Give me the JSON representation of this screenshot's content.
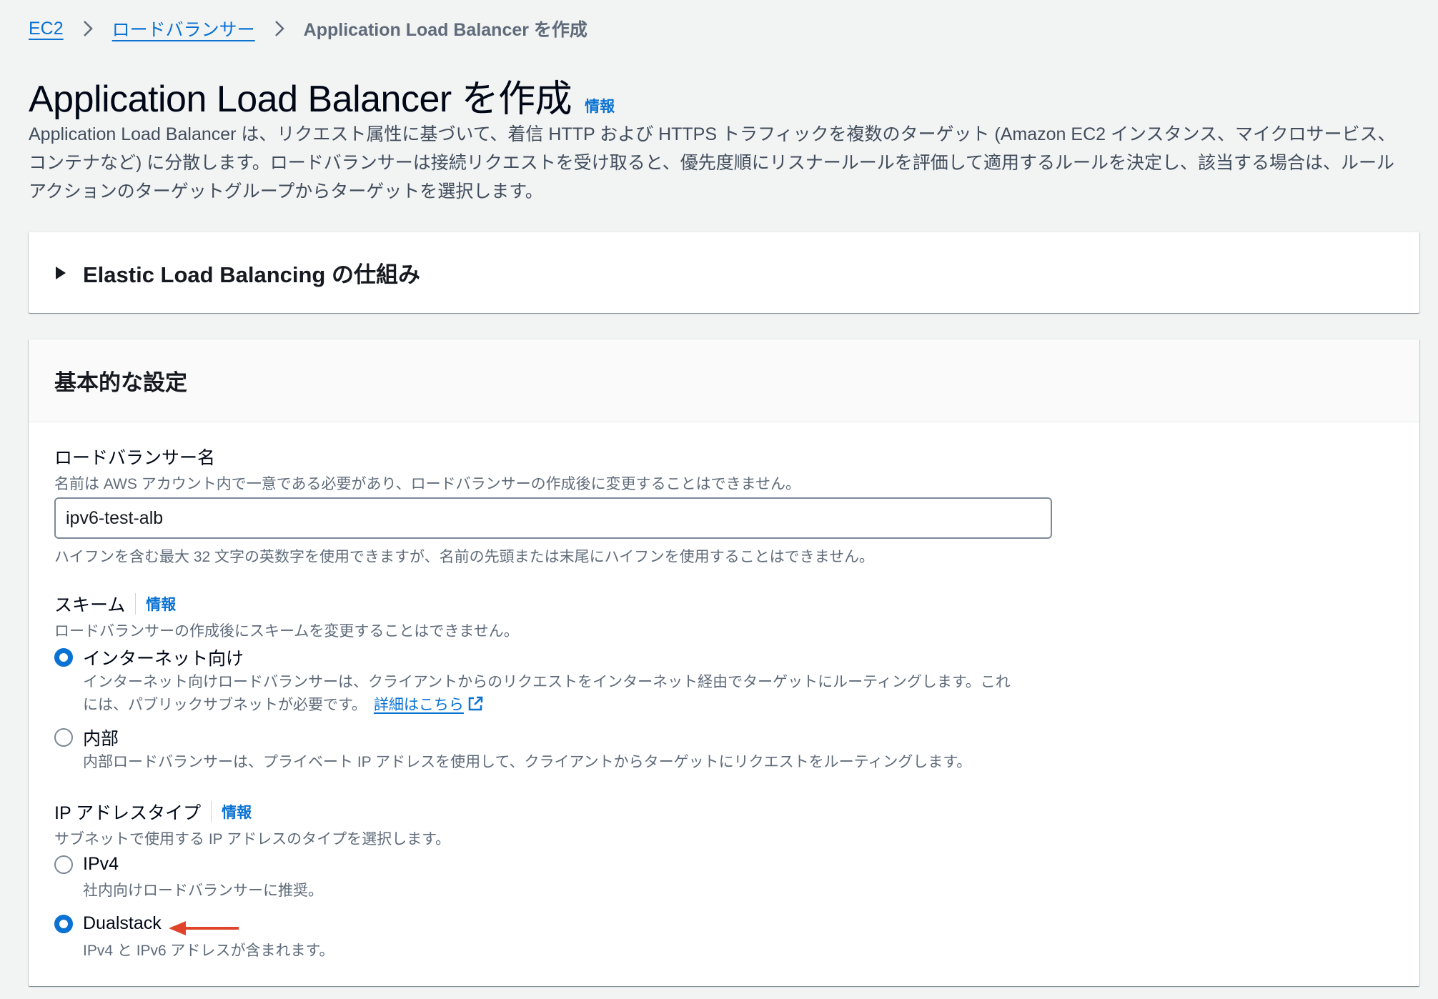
{
  "breadcrumb": {
    "items": [
      "EC2",
      "ロードバランサー"
    ],
    "current": "Application Load Balancer を作成"
  },
  "header": {
    "title": "Application Load Balancer を作成",
    "info": "情報",
    "description": "Application Load Balancer は、リクエスト属性に基づいて、着信 HTTP および HTTPS トラフィックを複数のターゲット (Amazon EC2 インスタンス、マイクロサービス、コンテナなど) に分散します。ロードバランサーは接続リクエストを受け取ると、優先度順にリスナールールを評価して適用するルールを決定し、該当する場合は、ルールアクションのターゲットグループからターゲットを選択します。"
  },
  "expander": {
    "title": "Elastic Load Balancing の仕組み"
  },
  "settings": {
    "title": "基本的な設定",
    "name_field": {
      "label": "ロードバランサー名",
      "description": "名前は AWS アカウント内で一意である必要があり、ロードバランサーの作成後に変更することはできません。",
      "value": "ipv6-test-alb",
      "constraint": "ハイフンを含む最大 32 文字の英数字を使用できますが、名前の先頭または末尾にハイフンを使用することはできません。"
    },
    "scheme": {
      "label": "スキーム",
      "info": "情報",
      "description": "ロードバランサーの作成後にスキームを変更することはできません。",
      "options": [
        {
          "label": "インターネット向け",
          "desc_line1": "インターネット向けロードバランサーは、クライアントからのリクエストをインターネット経由でターゲットにルーティングします。これ",
          "desc_line2": "には、パブリックサブネットが必要です。",
          "link": "詳細はこちら",
          "checked": true
        },
        {
          "label": "内部",
          "desc_line1": "内部ロードバランサーは、プライベート IP アドレスを使用して、クライアントからターゲットにリクエストをルーティングします。",
          "checked": false
        }
      ]
    },
    "ip_type": {
      "label": "IP アドレスタイプ",
      "info": "情報",
      "description": "サブネットで使用する IP アドレスのタイプを選択します。",
      "options": [
        {
          "label": "IPv4",
          "desc": "社内向けロードバランサーに推奨。",
          "checked": false
        },
        {
          "label": "Dualstack",
          "desc": "IPv4 と IPv6 アドレスが含まれます。",
          "checked": true
        }
      ]
    }
  },
  "colors": {
    "link": "#0972d3",
    "annotation_arrow": "#e0452b"
  }
}
